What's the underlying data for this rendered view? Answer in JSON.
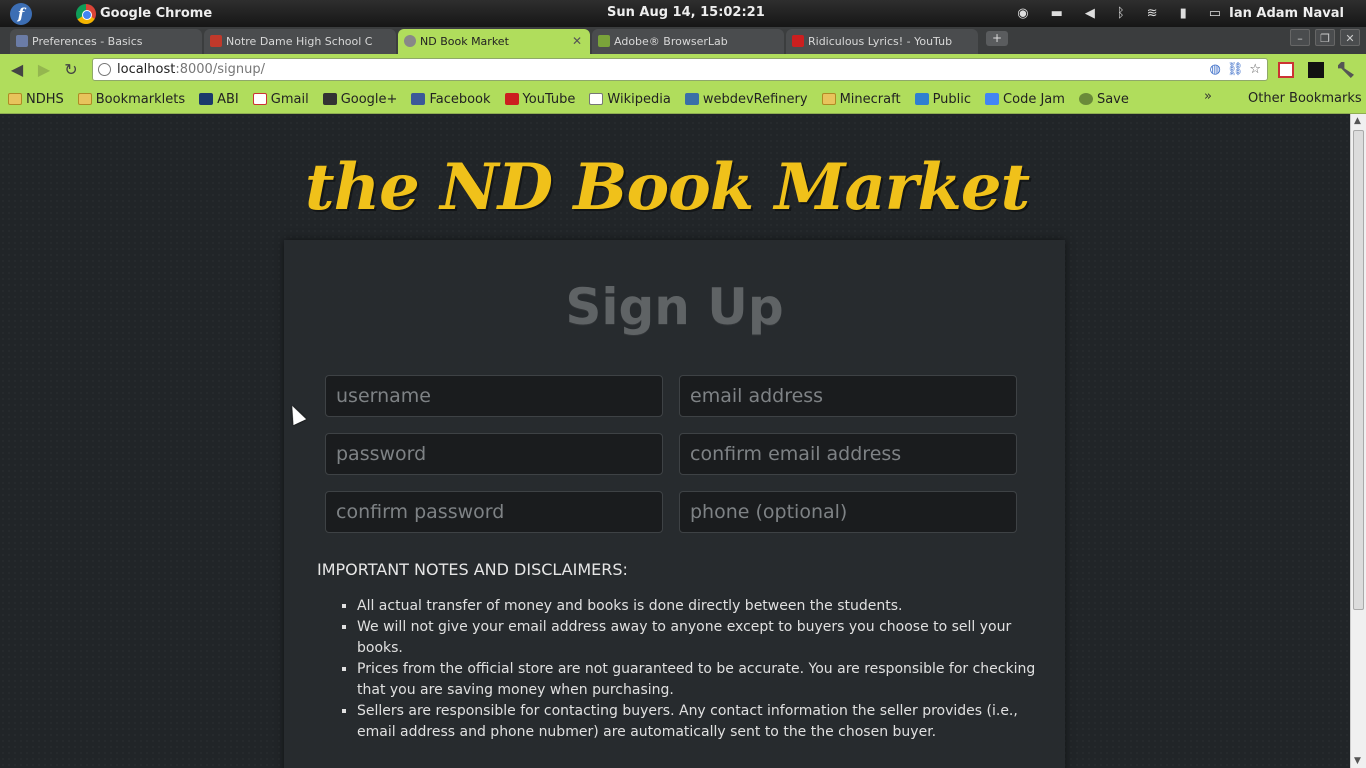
{
  "panel": {
    "app_name": "Google Chrome",
    "clock": "Sun Aug 14, 15:02:21",
    "user": "Ian Adam Naval"
  },
  "tabs": [
    {
      "title": "Preferences - Basics",
      "favicon_color": "#6b7ca6"
    },
    {
      "title": "Notre Dame High School C",
      "favicon_color": "#c0392b"
    },
    {
      "title": "ND Book Market",
      "favicon_color": "#888888",
      "active": true
    },
    {
      "title": "Adobe® BrowserLab",
      "favicon_color": "#7aa33a"
    },
    {
      "title": "Ridiculous Lyrics! - YouTub",
      "favicon_color": "#cc1f1f"
    }
  ],
  "toolbar": {
    "url_host": "localhost",
    "url_path": ":8000/signup/"
  },
  "bookmarks": [
    {
      "label": "NDHS",
      "icon": "folder-icon"
    },
    {
      "label": "Bookmarklets",
      "icon": "folder-icon"
    },
    {
      "label": "ABI",
      "icon": "nd-icon"
    },
    {
      "label": "Gmail",
      "icon": "gmail-icon"
    },
    {
      "label": "Google+",
      "icon": "google-plus-icon"
    },
    {
      "label": "Facebook",
      "icon": "facebook-icon"
    },
    {
      "label": "YouTube",
      "icon": "youtube-icon"
    },
    {
      "label": "Wikipedia",
      "icon": "wikipedia-icon"
    },
    {
      "label": "webdevRefinery",
      "icon": "webdev-icon"
    },
    {
      "label": "Minecraft",
      "icon": "folder-icon"
    },
    {
      "label": "Public",
      "icon": "dropbox-icon"
    },
    {
      "label": "Code Jam",
      "icon": "google-icon"
    },
    {
      "label": "Save",
      "icon": "save-icon"
    }
  ],
  "bookmarks_more": "»",
  "bookmarks_other": "Other Bookmarks",
  "page": {
    "site_title": "the ND Book Market",
    "heading": "Sign Up",
    "fields": {
      "username": "username",
      "email": "email address",
      "password": "password",
      "confirm_email": "confirm email address",
      "confirm_password": "confirm password",
      "phone": "phone (optional)"
    },
    "notes_title": "IMPORTANT NOTES AND DISCLAIMERS:",
    "notes": [
      "All actual transfer of money and books is done directly between the students.",
      "We will not give your email address away to anyone except to buyers you choose to sell your books.",
      "Prices from the official store are not guaranteed to be accurate. You are responsible for checking that you are saving money when purchasing.",
      "Sellers are responsible for contacting buyers. Any contact information the seller provides (i.e., email address and phone nubmer) are automatically sent to the the chosen buyer."
    ]
  },
  "colors": {
    "chrome_theme": "#b0dd5c",
    "title_gold": "#f0c11a",
    "page_bg": "#212528"
  }
}
